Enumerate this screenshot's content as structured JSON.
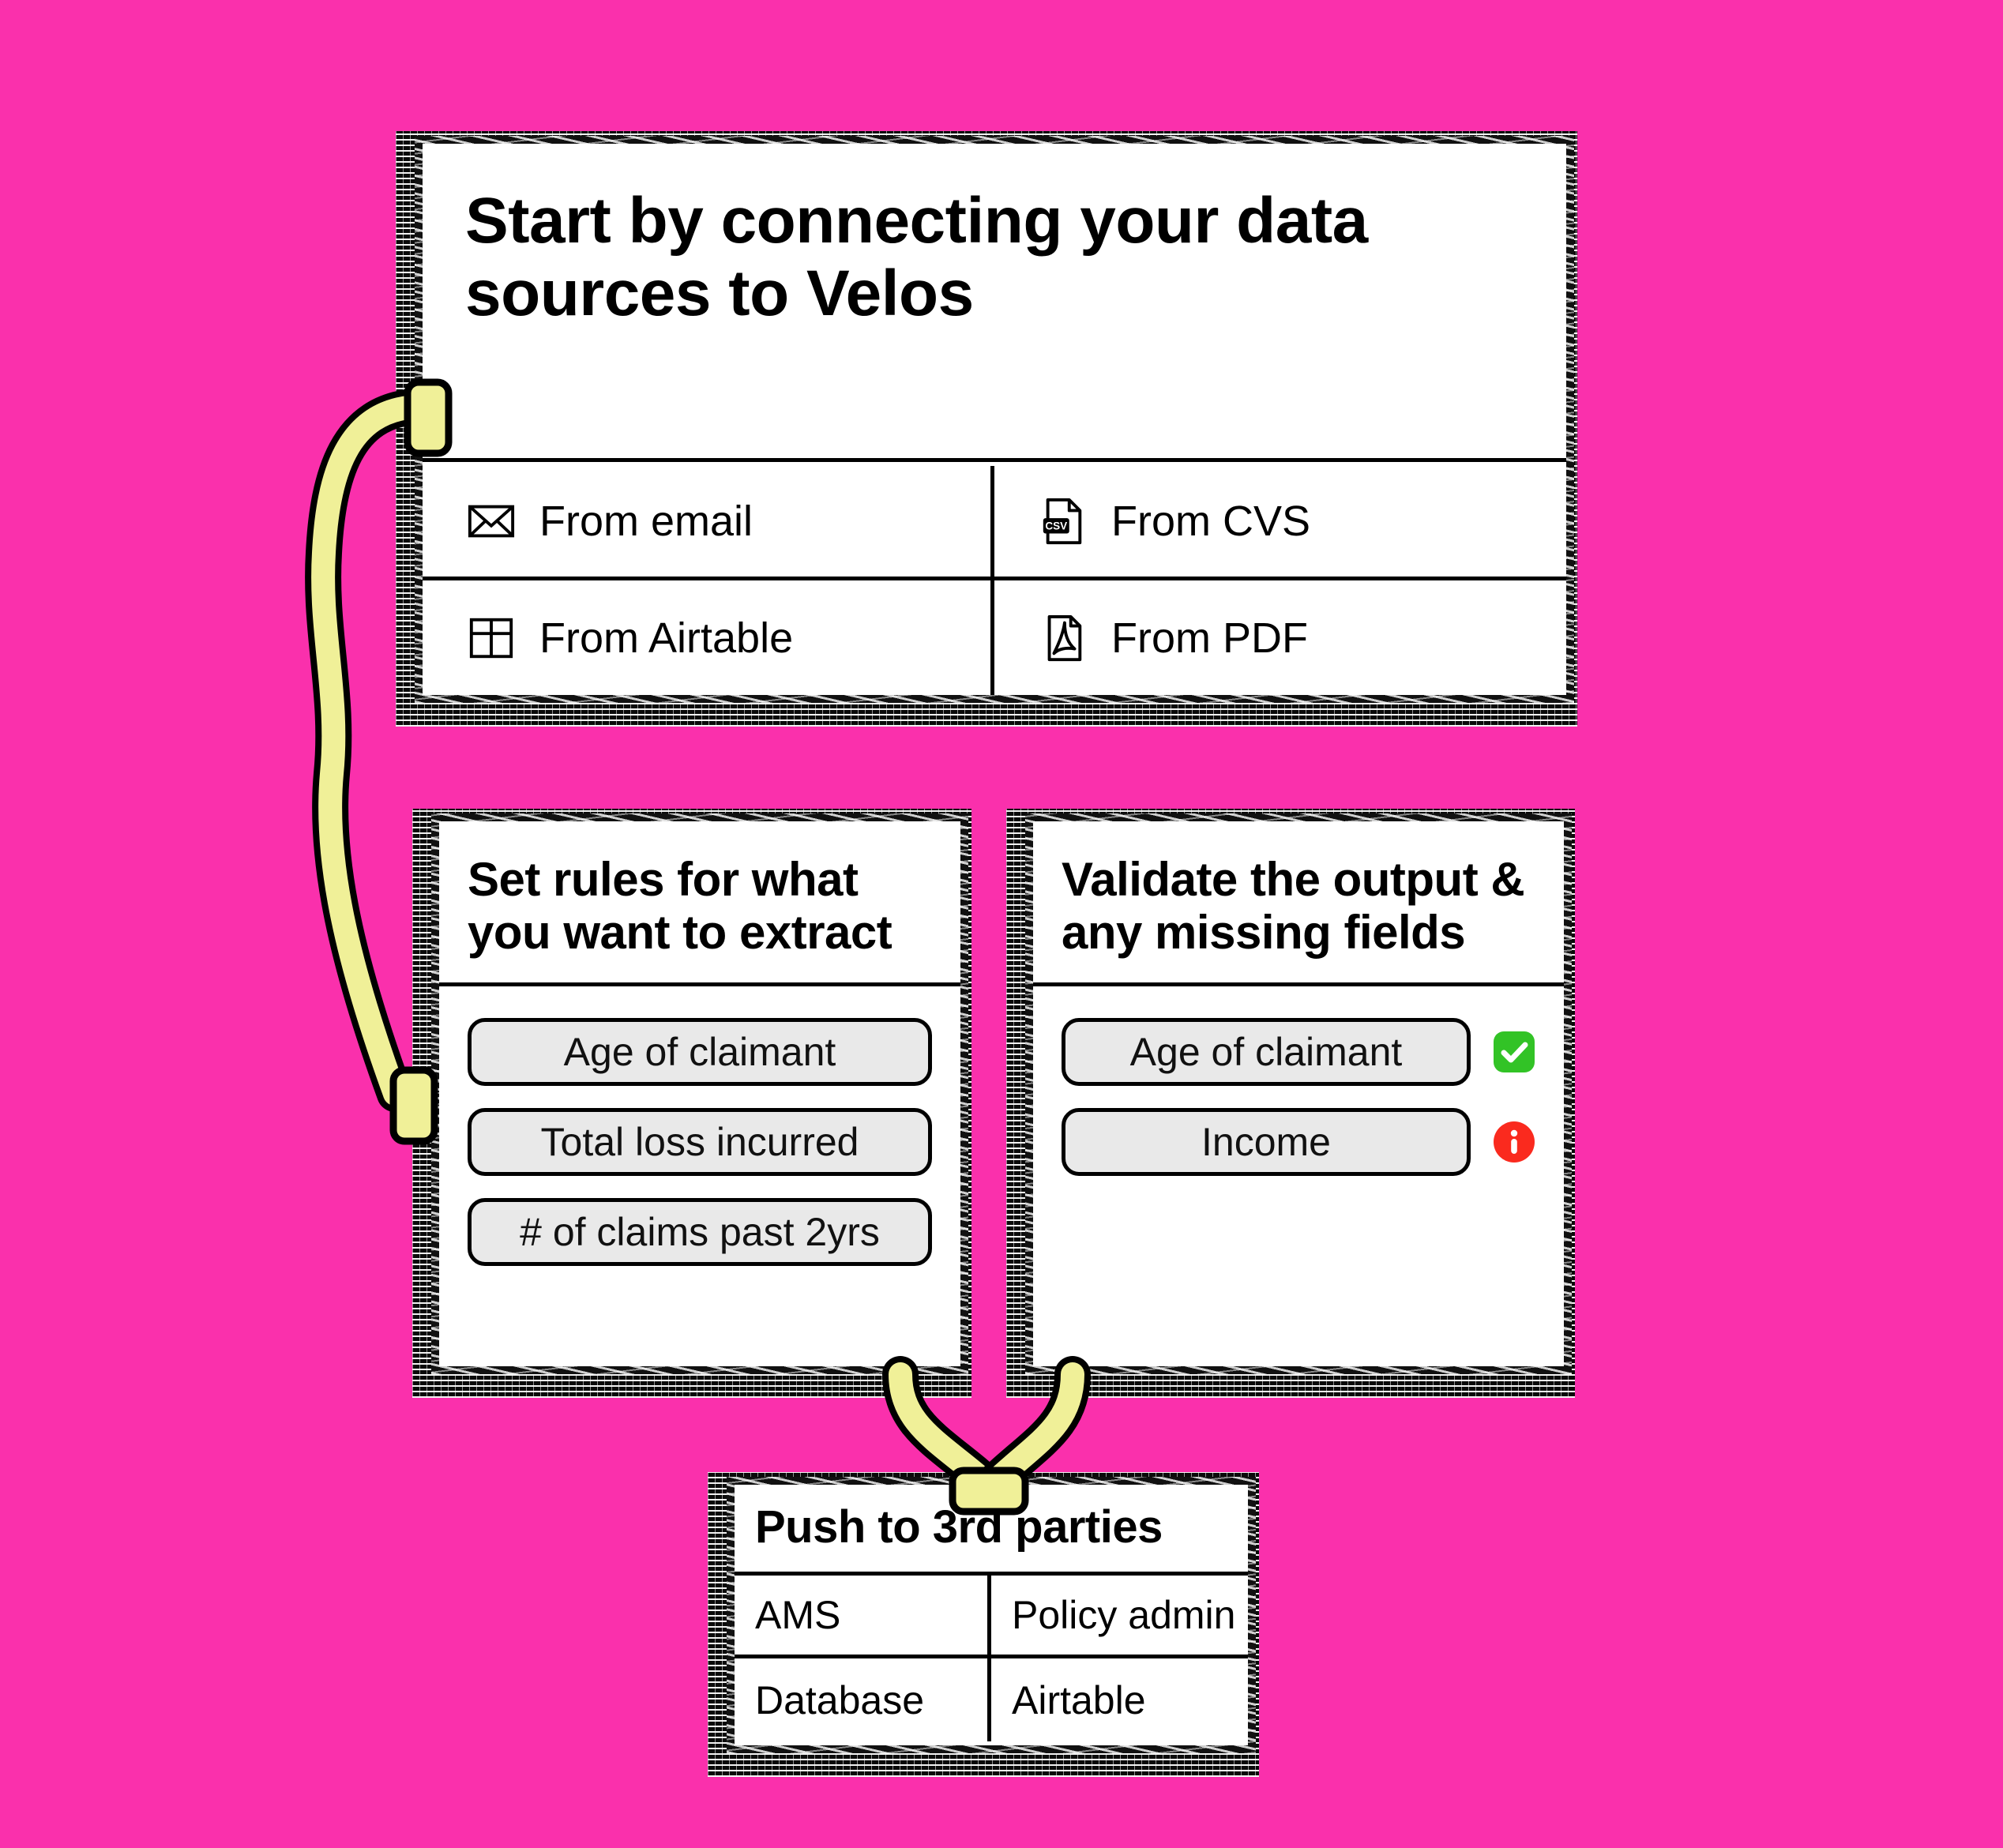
{
  "theme": {
    "background": "#fa30ac",
    "card_surface": "#ffffff",
    "ink": "#000000",
    "cable": "#f0f098",
    "chip_fill": "#e9e9e9",
    "status_ok": "#32c326",
    "status_warn": "#fa2a1e"
  },
  "cards": {
    "sources": {
      "title": "Start by connecting your data sources to Velos",
      "items": [
        {
          "label": "From email",
          "icon": "envelope-icon"
        },
        {
          "label": "From CVS",
          "icon": "csv-file-icon"
        },
        {
          "label": "From Airtable",
          "icon": "grid-table-icon"
        },
        {
          "label": "From PDF",
          "icon": "pdf-file-icon"
        }
      ]
    },
    "rules": {
      "title": "Set rules for what you want to extract",
      "fields": [
        {
          "label": "Age of claimant"
        },
        {
          "label": "Total loss incurred"
        },
        {
          "label": "# of claims past 2yrs"
        }
      ]
    },
    "validate": {
      "title": "Validate the output & any missing fields",
      "fields": [
        {
          "label": "Age of claimant",
          "status": "ok",
          "status_icon": "check-badge-icon"
        },
        {
          "label": "Income",
          "status": "warn",
          "status_icon": "info-circle-icon"
        }
      ]
    },
    "push": {
      "title": "Push to 3rd parties",
      "targets": [
        {
          "label": "AMS"
        },
        {
          "label": "Policy admin"
        },
        {
          "label": "Database"
        },
        {
          "label": "Airtable"
        }
      ]
    }
  },
  "connectors": [
    {
      "name": "sources-to-rules",
      "from": "sources-card-left-port",
      "to": "rules-card-left-port"
    },
    {
      "name": "rules-to-push",
      "from": "rules-card-bottom",
      "to": "push-card-top-port"
    },
    {
      "name": "validate-to-push",
      "from": "validate-card-bottom",
      "to": "push-card-top-port"
    }
  ]
}
